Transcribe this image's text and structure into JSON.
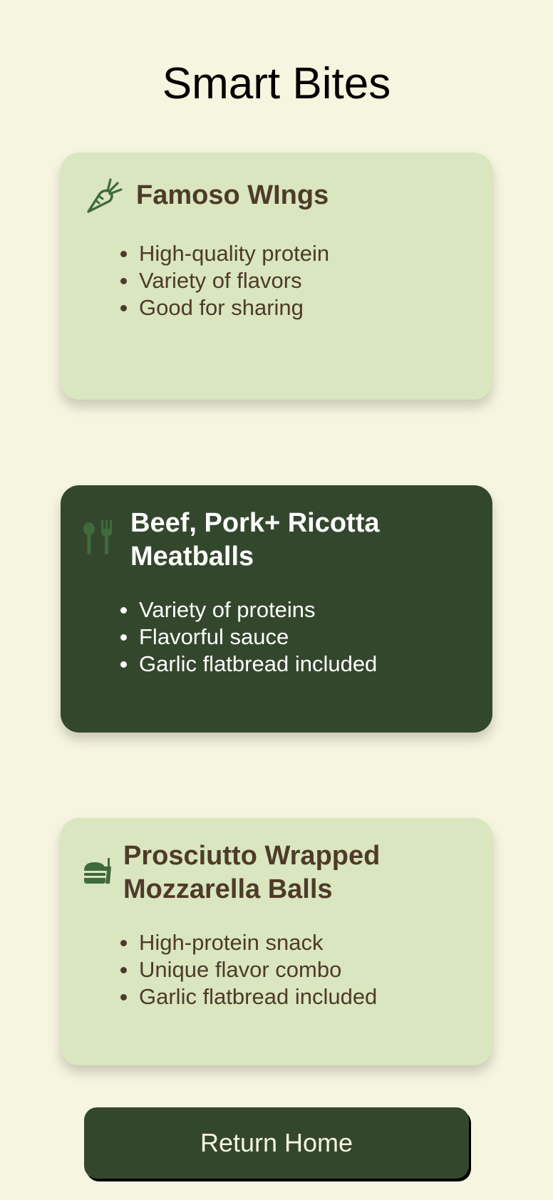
{
  "page": {
    "title": "Smart Bites"
  },
  "cards": [
    {
      "icon": "carrot-icon",
      "title": "Famoso WIngs",
      "items": [
        "High-quality protein",
        "Variety of flavors",
        "Good for sharing"
      ]
    },
    {
      "icon": "utensils-icon",
      "title_line1": "Beef, Pork+ Ricotta",
      "title_line2": "Meatballs",
      "items": [
        "Variety of proteins",
        "Flavorful sauce",
        "Garlic flatbread included"
      ]
    },
    {
      "icon": "burger-soda-icon",
      "title_line1": "Prosciutto Wrapped",
      "title_line2": "Mozzarella Balls",
      "items": [
        "High-protein snack",
        "Unique flavor combo",
        "Garlic flatbread included"
      ]
    }
  ],
  "actions": {
    "home_label": "Return Home"
  },
  "colors": {
    "background": "#f6f5df",
    "card_light": "#d9e6bf",
    "card_dark": "#33472d",
    "text_brown": "#4e3a2a",
    "icon_green": "#3f6a3d"
  }
}
